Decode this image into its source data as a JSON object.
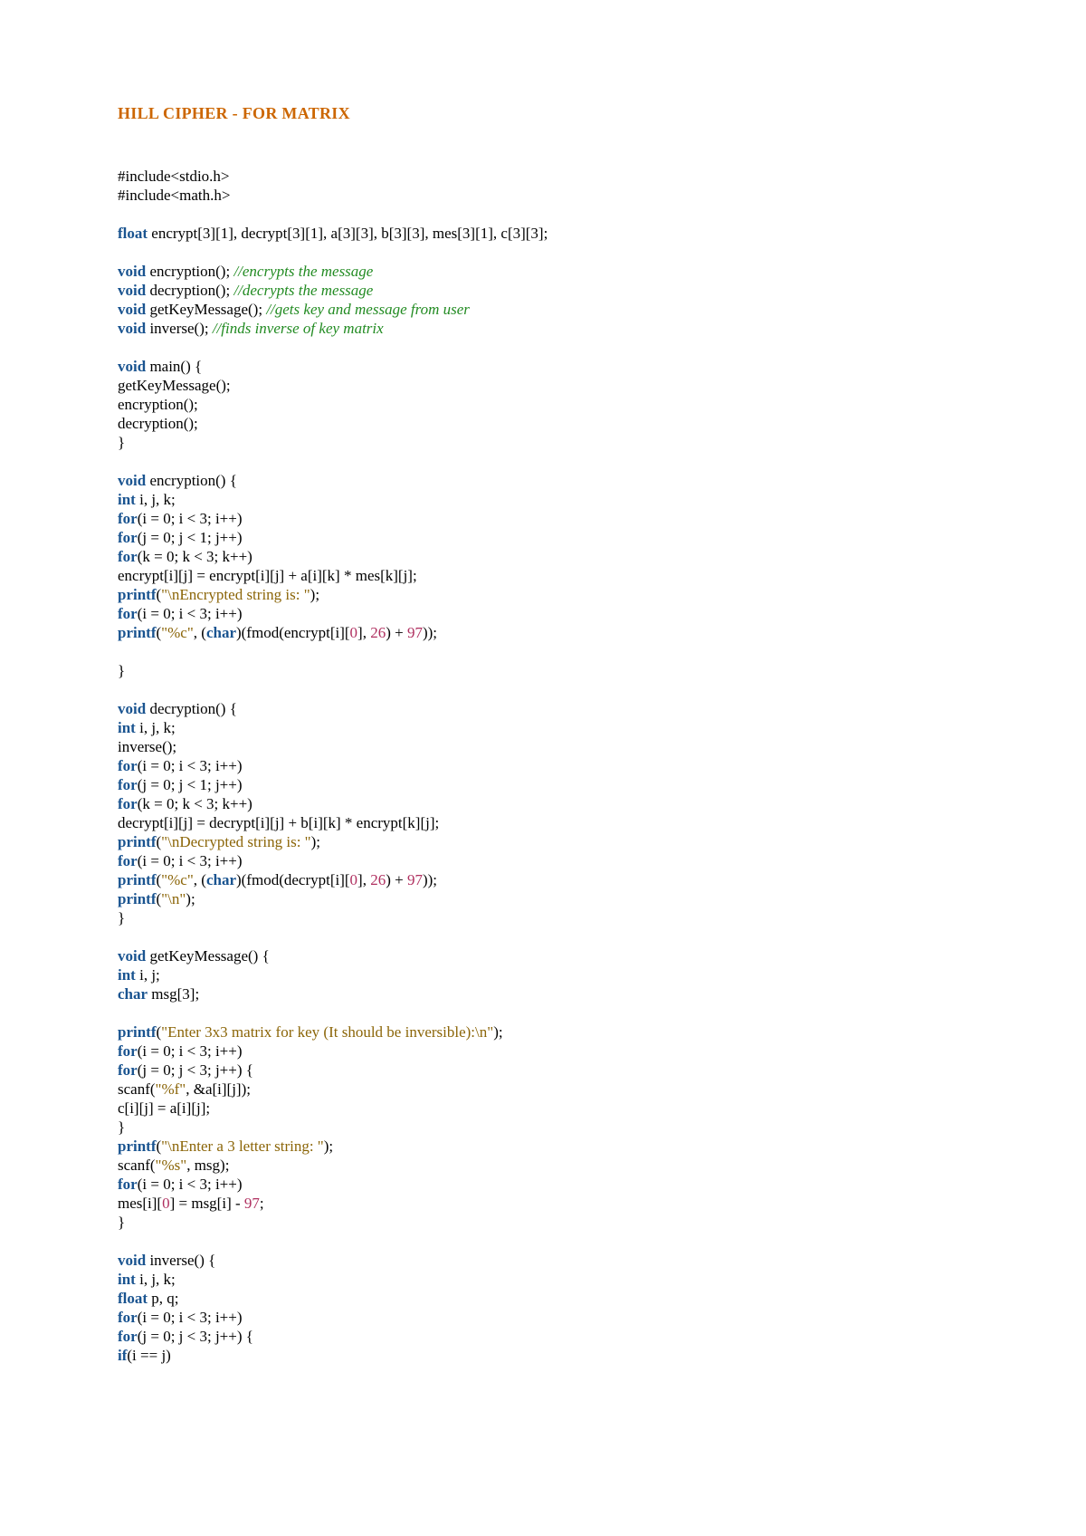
{
  "title": "HILL CIPHER - FOR MATRIX",
  "code_tokens": [
    [
      [
        "txt",
        "#include<stdio.h>"
      ]
    ],
    [
      [
        "txt",
        "#include<math.h>"
      ]
    ],
    [],
    [
      [
        "kw",
        "float"
      ],
      [
        "txt",
        " encrypt[3][1], decrypt[3][1], a[3][3], b[3][3], mes[3][1], c[3][3];"
      ]
    ],
    [],
    [
      [
        "kw",
        "void"
      ],
      [
        "txt",
        " encryption(); "
      ],
      [
        "cmt",
        "//encrypts the message"
      ]
    ],
    [
      [
        "kw",
        "void"
      ],
      [
        "txt",
        " decryption(); "
      ],
      [
        "cmt",
        "//decrypts the message"
      ]
    ],
    [
      [
        "kw",
        "void"
      ],
      [
        "txt",
        " getKeyMessage(); "
      ],
      [
        "cmt",
        "//gets key and message from user"
      ]
    ],
    [
      [
        "kw",
        "void"
      ],
      [
        "txt",
        " inverse(); "
      ],
      [
        "cmt",
        "//finds inverse of key matrix"
      ]
    ],
    [],
    [
      [
        "kw",
        "void"
      ],
      [
        "txt",
        " main() {"
      ]
    ],
    [
      [
        "txt",
        "getKeyMessage();"
      ]
    ],
    [
      [
        "txt",
        "encryption();"
      ]
    ],
    [
      [
        "txt",
        "decryption();"
      ]
    ],
    [
      [
        "txt",
        "}"
      ]
    ],
    [],
    [
      [
        "kw",
        "void"
      ],
      [
        "txt",
        " encryption() {"
      ]
    ],
    [
      [
        "kw",
        "int"
      ],
      [
        "txt",
        " i, j, k;"
      ]
    ],
    [
      [
        "kw",
        "for"
      ],
      [
        "txt",
        "(i = 0; i < 3; i++)"
      ]
    ],
    [
      [
        "kw",
        "for"
      ],
      [
        "txt",
        "(j = 0; j < 1; j++)"
      ]
    ],
    [
      [
        "kw",
        "for"
      ],
      [
        "txt",
        "(k = 0; k < 3; k++)"
      ]
    ],
    [
      [
        "txt",
        "encrypt[i][j] = encrypt[i][j] + a[i][k] * mes[k][j];"
      ]
    ],
    [
      [
        "fn",
        "printf"
      ],
      [
        "txt",
        "("
      ],
      [
        "str",
        "\"\\nEncrypted string is: \""
      ],
      [
        "txt",
        ");"
      ]
    ],
    [
      [
        "kw",
        "for"
      ],
      [
        "txt",
        "(i = 0; i < 3; i++)"
      ]
    ],
    [
      [
        "fn",
        "printf"
      ],
      [
        "txt",
        "("
      ],
      [
        "str",
        "\"%c\""
      ],
      [
        "txt",
        ", ("
      ],
      [
        "kw",
        "char"
      ],
      [
        "txt",
        ")(fmod(encrypt[i]["
      ],
      [
        "num",
        "0"
      ],
      [
        "txt",
        "], "
      ],
      [
        "num",
        "26"
      ],
      [
        "txt",
        ") + "
      ],
      [
        "num",
        "97"
      ],
      [
        "txt",
        "));"
      ]
    ],
    [],
    [
      [
        "txt",
        "}"
      ]
    ],
    [],
    [
      [
        "kw",
        "void"
      ],
      [
        "txt",
        " decryption() {"
      ]
    ],
    [
      [
        "kw",
        "int"
      ],
      [
        "txt",
        " i, j, k;"
      ]
    ],
    [
      [
        "txt",
        "inverse();"
      ]
    ],
    [
      [
        "kw",
        "for"
      ],
      [
        "txt",
        "(i = 0; i < 3; i++)"
      ]
    ],
    [
      [
        "kw",
        "for"
      ],
      [
        "txt",
        "(j = 0; j < 1; j++)"
      ]
    ],
    [
      [
        "kw",
        "for"
      ],
      [
        "txt",
        "(k = 0; k < 3; k++)"
      ]
    ],
    [
      [
        "txt",
        "decrypt[i][j] = decrypt[i][j] + b[i][k] * encrypt[k][j];"
      ]
    ],
    [
      [
        "fn",
        "printf"
      ],
      [
        "txt",
        "("
      ],
      [
        "str",
        "\"\\nDecrypted string is: \""
      ],
      [
        "txt",
        ");"
      ]
    ],
    [
      [
        "kw",
        "for"
      ],
      [
        "txt",
        "(i = 0; i < 3; i++)"
      ]
    ],
    [
      [
        "fn",
        "printf"
      ],
      [
        "txt",
        "("
      ],
      [
        "str",
        "\"%c\""
      ],
      [
        "txt",
        ", ("
      ],
      [
        "kw",
        "char"
      ],
      [
        "txt",
        ")(fmod(decrypt[i]["
      ],
      [
        "num",
        "0"
      ],
      [
        "txt",
        "], "
      ],
      [
        "num",
        "26"
      ],
      [
        "txt",
        ") + "
      ],
      [
        "num",
        "97"
      ],
      [
        "txt",
        "));"
      ]
    ],
    [
      [
        "fn",
        "printf"
      ],
      [
        "txt",
        "("
      ],
      [
        "str",
        "\"\\n\""
      ],
      [
        "txt",
        ");"
      ]
    ],
    [
      [
        "txt",
        "}"
      ]
    ],
    [],
    [
      [
        "kw",
        "void"
      ],
      [
        "txt",
        " getKeyMessage() {"
      ]
    ],
    [
      [
        "kw",
        "int"
      ],
      [
        "txt",
        " i, j;"
      ]
    ],
    [
      [
        "kw",
        "char"
      ],
      [
        "txt",
        " msg[3];"
      ]
    ],
    [],
    [
      [
        "fn",
        "printf"
      ],
      [
        "txt",
        "("
      ],
      [
        "str",
        "\"Enter 3x3 matrix for key (It should be inversible):\\n\""
      ],
      [
        "txt",
        ");"
      ]
    ],
    [
      [
        "kw",
        "for"
      ],
      [
        "txt",
        "(i = 0; i < 3; i++)"
      ]
    ],
    [
      [
        "kw",
        "for"
      ],
      [
        "txt",
        "(j = 0; j < 3; j++) {"
      ]
    ],
    [
      [
        "txt",
        "scanf("
      ],
      [
        "str",
        "\"%f\""
      ],
      [
        "txt",
        ", &a[i][j]);"
      ]
    ],
    [
      [
        "txt",
        "c[i][j] = a[i][j];"
      ]
    ],
    [
      [
        "txt",
        "}"
      ]
    ],
    [
      [
        "fn",
        "printf"
      ],
      [
        "txt",
        "("
      ],
      [
        "str",
        "\"\\nEnter a 3 letter string: \""
      ],
      [
        "txt",
        ");"
      ]
    ],
    [
      [
        "txt",
        "scanf("
      ],
      [
        "str",
        "\"%s\""
      ],
      [
        "txt",
        ", msg);"
      ]
    ],
    [
      [
        "kw",
        "for"
      ],
      [
        "txt",
        "(i = 0; i < 3; i++)"
      ]
    ],
    [
      [
        "txt",
        "mes[i]["
      ],
      [
        "num",
        "0"
      ],
      [
        "txt",
        "] = msg[i] - "
      ],
      [
        "num",
        "97"
      ],
      [
        "txt",
        ";"
      ]
    ],
    [
      [
        "txt",
        "}"
      ]
    ],
    [],
    [
      [
        "kw",
        "void"
      ],
      [
        "txt",
        " inverse() {"
      ]
    ],
    [
      [
        "kw",
        "int"
      ],
      [
        "txt",
        " i, j, k;"
      ]
    ],
    [
      [
        "kw",
        "float"
      ],
      [
        "txt",
        " p, q;"
      ]
    ],
    [
      [
        "kw",
        "for"
      ],
      [
        "txt",
        "(i = 0; i < 3; i++)"
      ]
    ],
    [
      [
        "kw",
        "for"
      ],
      [
        "txt",
        "(j = 0; j < 3; j++) {"
      ]
    ],
    [
      [
        "kw",
        "if"
      ],
      [
        "txt",
        "(i == j)"
      ]
    ]
  ]
}
